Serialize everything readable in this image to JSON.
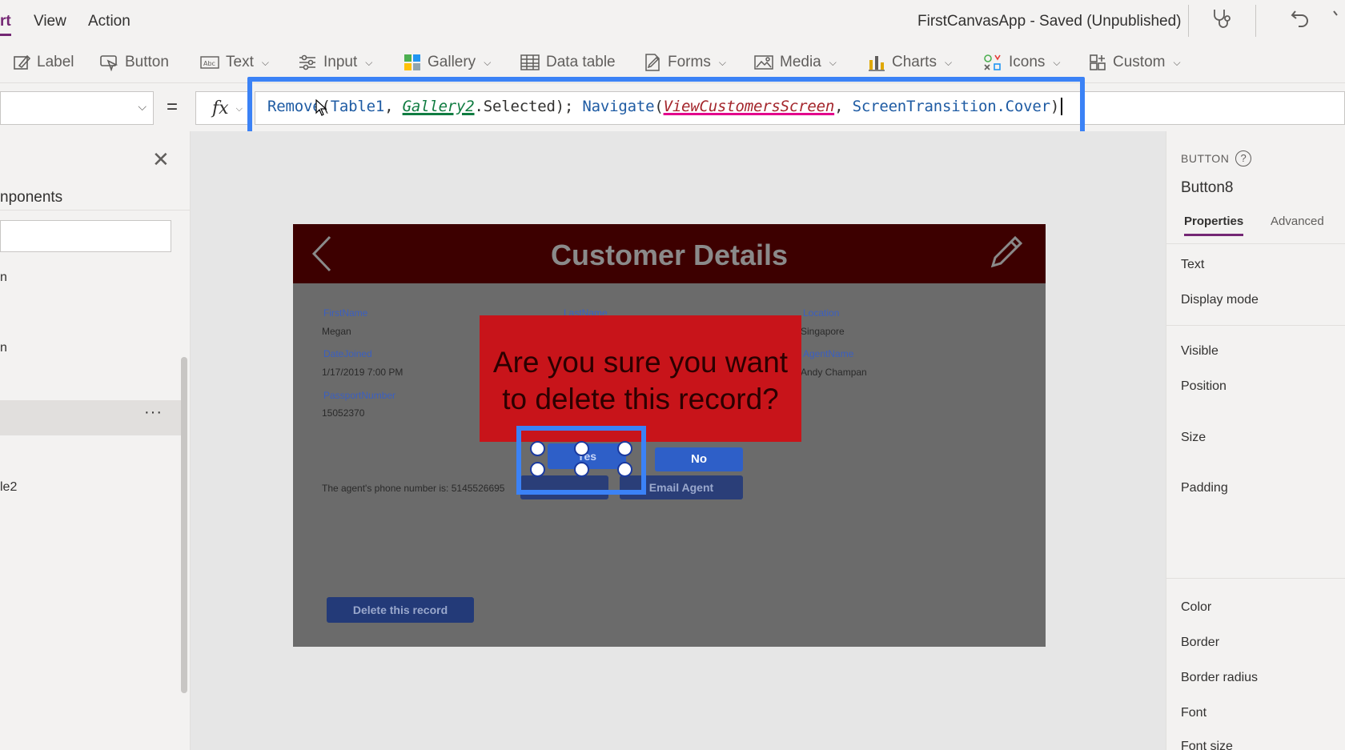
{
  "menu": {
    "insert": "rt",
    "view": "View",
    "action": "Action"
  },
  "app_title": "FirstCanvasApp - Saved (Unpublished)",
  "ribbon": {
    "label": "Label",
    "button": "Button",
    "text": "Text",
    "input": "Input",
    "gallery": "Gallery",
    "data_table": "Data table",
    "forms": "Forms",
    "media": "Media",
    "charts": "Charts",
    "icons": "Icons",
    "custom": "Custom"
  },
  "formula": {
    "equals": "=",
    "fx": "fx",
    "tokens": {
      "remove": "Remove",
      "open1": "(",
      "table": "Table1",
      "sep1": ", ",
      "gallery": "Gallery2",
      "selected": ".Selected); ",
      "navigate": "Navigate",
      "open2": "(",
      "screen": "ViewCustomersScreen",
      "sep2": ", ",
      "transition": "ScreenTransition",
      "cover": ".Cover",
      "close": ")"
    }
  },
  "left_panel": {
    "components": "nponents",
    "tree": [
      "n",
      "n",
      "le2"
    ],
    "more": "···"
  },
  "screen": {
    "title": "Customer Details",
    "fields": {
      "firstname_label": "FirstName",
      "firstname_value": "Megan",
      "lastname_label": "LastName",
      "location_label": "Location",
      "location_value": "Singapore",
      "datejoined_label": "DateJoined",
      "datejoined_value": "1/17/2019 7:00 PM",
      "agentname_label": "AgentName",
      "agentname_value": "Andy Champan",
      "passport_label": "PassportNumber",
      "passport_value": "15052370"
    },
    "phone_text": "The agent's phone number is: 5145526695",
    "email_button": "Email Agent",
    "delete_button": "Delete this record",
    "confirm_text": "Are you sure you want to delete this record?",
    "yes_button": "Yes",
    "no_button": "No"
  },
  "right_panel": {
    "type": "BUTTON",
    "help": "?",
    "name": "Button8",
    "tab_properties": "Properties",
    "tab_advanced": "Advanced",
    "props": [
      "Text",
      "Display mode",
      "Visible",
      "Position",
      "Size",
      "Padding",
      "Color",
      "Border",
      "Border radius",
      "Font",
      "Font size"
    ]
  },
  "colors": {
    "accent": "#742774",
    "highlight": "#3b82f6",
    "header": "#3d0000",
    "confirm": "#c8141a",
    "button": "#2e5fc8"
  },
  "icons": [
    "undo-icon",
    "stethoscope-icon",
    "label-icon",
    "button-icon",
    "text-icon",
    "input-icon",
    "gallery-icon",
    "data-table-icon",
    "forms-icon",
    "media-icon",
    "charts-icon",
    "icons-icon",
    "custom-icon",
    "close-icon",
    "back-chevron-icon",
    "edit-pencil-icon",
    "help-icon",
    "cursor-icon"
  ]
}
